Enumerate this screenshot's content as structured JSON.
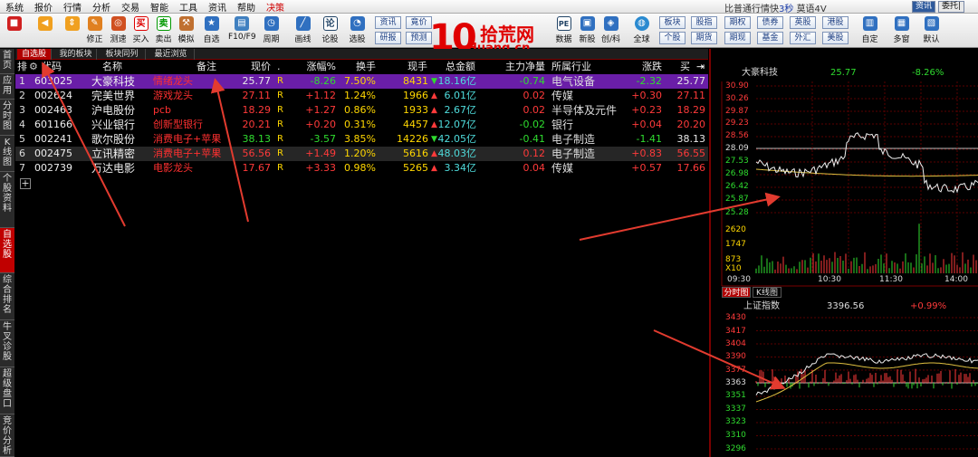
{
  "menubar": {
    "items": [
      "系统",
      "报价",
      "行情",
      "分析",
      "交易",
      "智能",
      "工具",
      "资讯",
      "帮助",
      "决策"
    ],
    "ticker_prefix": "比普通行情快",
    "ticker_highlight": "3秒",
    "ticker_suffix": "莫语4V",
    "buttons": [
      "资讯",
      "委托|"
    ]
  },
  "toolbar": {
    "items": [
      {
        "icon": "red-squares-icon",
        "label": ""
      },
      {
        "icon": "arrow-left-icon",
        "label": ""
      },
      {
        "icon": "arrow-up-down-icon",
        "label": ""
      },
      {
        "icon": "edit-icon",
        "label": "修正"
      },
      {
        "icon": "test-icon",
        "label": "测速"
      },
      {
        "icon": "buy-icon",
        "label": "买入"
      },
      {
        "icon": "sell-icon",
        "label": "卖出"
      },
      {
        "icon": "hammer-icon",
        "label": "模拟"
      },
      {
        "icon": "watchlist-icon",
        "label": "自选"
      },
      {
        "icon": "f10-icon",
        "label": "F10/F9"
      },
      {
        "icon": "clock-icon",
        "label": "周期"
      },
      {
        "icon": "draw-icon",
        "label": "画线"
      },
      {
        "icon": "log-icon",
        "label": "论股"
      },
      {
        "icon": "select-icon",
        "label": "选股"
      }
    ],
    "small_buttons": [
      "资讯",
      "竟价",
      "研报",
      "预测",
      "PE",
      "板块",
      "股指",
      "期权",
      "债券",
      "英股",
      "港股",
      "个股",
      "期货",
      "期现",
      "基金",
      "外汇",
      "美股"
    ],
    "right_items": [
      {
        "icon": "pe-icon",
        "label": "数据"
      },
      {
        "icon": "new-stock-icon",
        "label": "新股"
      },
      {
        "icon": "innovation-icon",
        "label": "创/科"
      },
      {
        "icon": "globe-icon",
        "label": "全球"
      },
      {
        "icon": "custom-icon",
        "label": "自定"
      },
      {
        "icon": "multi-screen-icon",
        "label": "多窗"
      },
      {
        "icon": "default-icon",
        "label": "默认"
      }
    ]
  },
  "logo": {
    "num": "10",
    "cn": "拾荒网",
    "en": "Huang.cn"
  },
  "lefttabs": [
    "首页",
    "应用",
    "分时图",
    "K线图",
    "个股资料",
    "自选股",
    "综合排名",
    "牛叉诊股",
    "超级盘口",
    "竞价分析"
  ],
  "tabs": [
    "自选股",
    "我的板块",
    "板块同列",
    "最近浏览"
  ],
  "table": {
    "headers": [
      "排",
      "",
      "代码",
      "名称",
      "备注",
      "现价",
      "",
      "涨幅%",
      "换手",
      "现手",
      "总金额",
      "主力净量",
      "所属行业",
      "涨跌",
      "买价"
    ],
    "rows": [
      {
        "idx": "1",
        "code": "603025",
        "name": "大豪科技",
        "note": "情绪龙头",
        "price": "25.77",
        "tag": "R",
        "chg": "-8.26",
        "turn": "7.50%",
        "vol": "8431",
        "volDir": "down",
        "amt": "18.16",
        "unit": "亿",
        "main": "-0.74",
        "ind": "电气设备",
        "diff": "-2.32",
        "bid": "25.77"
      },
      {
        "idx": "2",
        "code": "002624",
        "name": "完美世界",
        "note": "游戏龙头",
        "price": "27.11",
        "tag": "R",
        "chg": "+1.12",
        "turn": "1.24%",
        "vol": "1966",
        "volDir": "up",
        "amt": "6.01",
        "unit": "亿",
        "main": "0.02",
        "ind": "传媒",
        "diff": "+0.30",
        "bid": "27.11"
      },
      {
        "idx": "3",
        "code": "002463",
        "name": "沪电股份",
        "note": "pcb",
        "price": "18.29",
        "tag": "R",
        "chg": "+1.27",
        "turn": "0.86%",
        "vol": "1933",
        "volDir": "up",
        "amt": "2.67",
        "unit": "亿",
        "main": "0.02",
        "ind": "半导体及元件",
        "diff": "+0.23",
        "bid": "18.29"
      },
      {
        "idx": "4",
        "code": "601166",
        "name": "兴业银行",
        "note": "创新型银行",
        "price": "20.21",
        "tag": "R",
        "chg": "+0.20",
        "turn": "0.31%",
        "vol": "4457",
        "volDir": "up",
        "amt": "12.07",
        "unit": "亿",
        "main": "-0.02",
        "ind": "银行",
        "diff": "+0.04",
        "bid": "20.20"
      },
      {
        "idx": "5",
        "code": "002241",
        "name": "歌尔股份",
        "note": "消费电子+苹果",
        "price": "38.13",
        "tag": "R",
        "chg": "-3.57",
        "turn": "3.85%",
        "vol": "14226",
        "volDir": "down",
        "amt": "42.05",
        "unit": "亿",
        "main": "-0.41",
        "ind": "电子制造",
        "diff": "-1.41",
        "bid": "38.13"
      },
      {
        "idx": "6",
        "code": "002475",
        "name": "立讯精密",
        "note": "消费电子+苹果",
        "price": "56.56",
        "tag": "R",
        "chg": "+1.49",
        "turn": "1.20%",
        "vol": "5616",
        "volDir": "up",
        "amt": "48.03",
        "unit": "亿",
        "main": "0.12",
        "ind": "电子制造",
        "diff": "+0.83",
        "bid": "56.55"
      },
      {
        "idx": "7",
        "code": "002739",
        "name": "万达电影",
        "note": "电影龙头",
        "price": "17.67",
        "tag": "R",
        "chg": "+3.33",
        "turn": "0.98%",
        "vol": "5265",
        "volDir": "up",
        "amt": "3.34",
        "unit": "亿",
        "main": "0.04",
        "ind": "传媒",
        "diff": "+0.57",
        "bid": "17.66"
      }
    ],
    "add_symbol": "+"
  },
  "panel": {
    "stock_name": "大豪科技",
    "stock_price": "25.77",
    "stock_change": "-8.26%",
    "price_labels": [
      "30.90",
      "30.26",
      "29.87",
      "29.23",
      "28.56",
      "28.09",
      "27.53",
      "26.98",
      "26.42",
      "25.87",
      "25.28"
    ],
    "volume_labels": [
      "2620",
      "1747",
      "873",
      "X10"
    ],
    "time_labels": [
      "09:30",
      "10:30",
      "11:30",
      "14:00"
    ],
    "tabs": [
      "分时图",
      "K线图"
    ],
    "index_name": "上证指数",
    "index_value": "3396.56",
    "index_change": "+0.99%",
    "index_labels": [
      "3430",
      "3417",
      "3404",
      "3390",
      "3377",
      "3363",
      "3351",
      "3337",
      "3323",
      "3310",
      "3296"
    ]
  },
  "colors": {
    "up": "#ff3a3a",
    "down": "#2fdc2f",
    "accent": "#b00000",
    "selected_row": "#6a1ea8"
  }
}
